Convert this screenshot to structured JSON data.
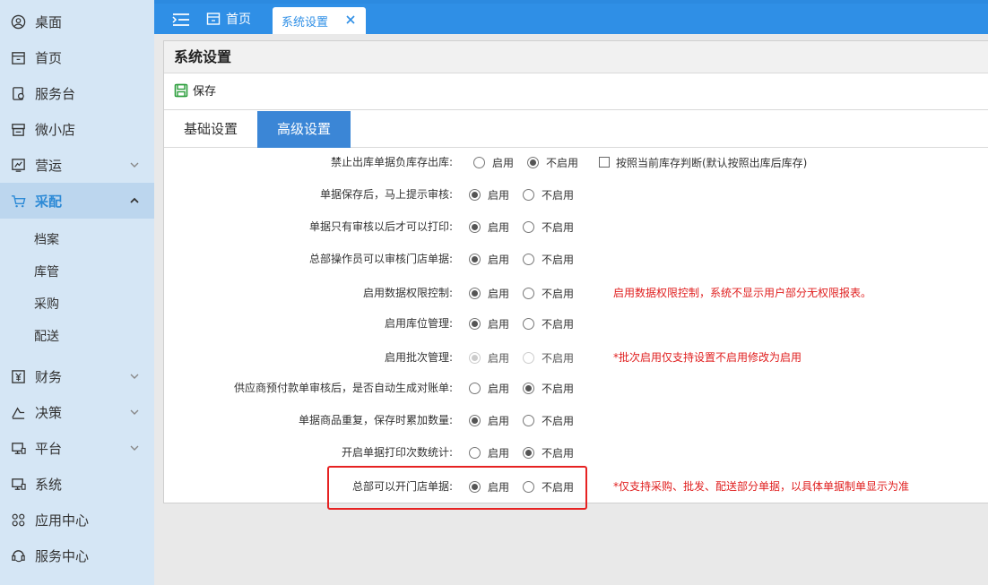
{
  "sidebar": {
    "items": [
      {
        "label": "桌面",
        "icon": "desktop-icon"
      },
      {
        "label": "首页",
        "icon": "home-icon"
      },
      {
        "label": "服务台",
        "icon": "service-desk-icon"
      },
      {
        "label": "微小店",
        "icon": "shop-icon"
      },
      {
        "label": "营运",
        "icon": "operations-icon"
      },
      {
        "label": "采配",
        "icon": "cart-icon"
      },
      {
        "label": "财务",
        "icon": "finance-icon"
      },
      {
        "label": "决策",
        "icon": "decision-icon"
      },
      {
        "label": "平台",
        "icon": "platform-icon"
      },
      {
        "label": "系统",
        "icon": "system-icon"
      },
      {
        "label": "应用中心",
        "icon": "app-center-icon"
      },
      {
        "label": "服务中心",
        "icon": "service-center-icon"
      }
    ],
    "subitems": [
      "档案",
      "库管",
      "采购",
      "配送"
    ]
  },
  "tabs": {
    "home": "首页",
    "active": "系统设置"
  },
  "panel": {
    "title": "系统设置",
    "save_label": "保存",
    "subtabs": [
      "基础设置",
      "高级设置"
    ]
  },
  "options": {
    "on": "启用",
    "off": "不启用"
  },
  "settings": [
    {
      "label": "禁止出库单据负库存出库:",
      "selected": "off",
      "extra_checkbox": "按照当前库存判断(默认按照出库后库存)"
    },
    {
      "label": "单据保存后，马上提示审核:",
      "selected": "on"
    },
    {
      "label": "单据只有审核以后才可以打印:",
      "selected": "on"
    },
    {
      "label": "总部操作员可以审核门店单据:",
      "selected": "on"
    },
    {
      "label": "启用数据权限控制:",
      "selected": "on",
      "note": "启用数据权限控制，系统不显示用户部分无权限报表。"
    },
    {
      "label": "启用库位管理:",
      "selected": "on"
    },
    {
      "label": "启用批次管理:",
      "selected": "on",
      "disabled": true,
      "note": "*批次启用仅支持设置不启用修改为启用"
    },
    {
      "label": "供应商预付款单审核后，是否自动生成对账单:",
      "selected": "off"
    },
    {
      "label": "单据商品重复，保存时累加数量:",
      "selected": "on"
    },
    {
      "label": "开启单据打印次数统计:",
      "selected": "off"
    },
    {
      "label": "总部可以开门店单据:",
      "selected": "on",
      "note": "*仅支持采购、批发、配送部分单据，以具体单据制单显示为准"
    }
  ],
  "colors": {
    "accent": "#2f8fe6",
    "sidebar_bg": "#d5e6f5",
    "note_red": "#e02020",
    "highlight_red": "#e62222",
    "save_green": "#2a9d3a"
  }
}
